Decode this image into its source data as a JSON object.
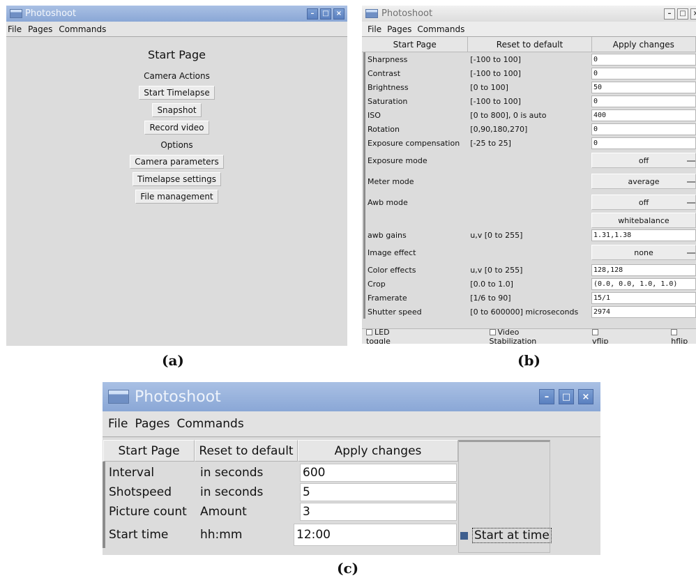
{
  "common": {
    "window_title": "Photoshoot",
    "menu": [
      "File",
      "Pages",
      "Commands"
    ],
    "window_buttons": [
      "minimize-icon",
      "maximize-icon",
      "close-icon"
    ]
  },
  "captions": {
    "a": "(a)",
    "b": "(b)",
    "c": "(c)"
  },
  "panel_a": {
    "title": "Start Page",
    "camera_actions_label": "Camera Actions",
    "camera_actions": [
      "Start Timelapse",
      "Snapshot",
      "Record video"
    ],
    "options_label": "Options",
    "options": [
      "Camera parameters",
      "Timelapse settings",
      "File management"
    ]
  },
  "panel_b": {
    "header": [
      "Start Page",
      "Reset to default",
      "Apply changes"
    ],
    "rows": [
      {
        "name": "Sharpness",
        "range": "[-100 to 100]",
        "value": "0",
        "kind": "input"
      },
      {
        "name": "Contrast",
        "range": "[-100 to 100]",
        "value": "0",
        "kind": "input"
      },
      {
        "name": "Brightness",
        "range": "[0 to 100]",
        "value": "50",
        "kind": "input"
      },
      {
        "name": "Saturation",
        "range": "[-100 to 100]",
        "value": "0",
        "kind": "input"
      },
      {
        "name": "ISO",
        "range": "[0 to 800], 0 is auto",
        "value": "400",
        "kind": "input"
      },
      {
        "name": "Rotation",
        "range": "[0,90,180,270]",
        "value": "0",
        "kind": "input"
      },
      {
        "name": "Exposure compensation",
        "range": "[-25 to 25]",
        "value": "0",
        "kind": "input"
      },
      {
        "name": "Exposure mode",
        "range": "",
        "value": "off",
        "kind": "select"
      },
      {
        "name": "Meter mode",
        "range": "",
        "value": "average",
        "kind": "select"
      },
      {
        "name": "Awb mode",
        "range": "",
        "value": "off",
        "kind": "select"
      },
      {
        "name": "",
        "range": "",
        "value": "whitebalance",
        "kind": "button"
      },
      {
        "name": "awb gains",
        "range": "u,v [0 to 255]",
        "value": "1.31,1.38",
        "kind": "input"
      },
      {
        "name": "Image effect",
        "range": "",
        "value": "none",
        "kind": "select"
      },
      {
        "name": "Color effects",
        "range": "u,v [0 to 255]",
        "value": "128,128",
        "kind": "input"
      },
      {
        "name": "Crop",
        "range": "[0.0 to 1.0]",
        "value": "(0.0, 0.0, 1.0, 1.0)",
        "kind": "input"
      },
      {
        "name": "Framerate",
        "range": "[1/6 to 90]",
        "value": "15/1",
        "kind": "input"
      },
      {
        "name": "Shutter speed",
        "range": "[0 to 600000] microseconds",
        "value": "2974",
        "kind": "input"
      }
    ],
    "toggles": [
      "LED toggle",
      "Video Stabilization",
      "vflip",
      "hflip"
    ]
  },
  "panel_c": {
    "header": [
      "Start Page",
      "Reset to default",
      "Apply changes"
    ],
    "rows": [
      {
        "name": "Interval",
        "unit": "in seconds",
        "value": "600"
      },
      {
        "name": "Shotspeed",
        "unit": "in seconds",
        "value": "5"
      },
      {
        "name": "Picture count",
        "unit": "Amount",
        "value": "3"
      },
      {
        "name": "Start time",
        "unit": "hh:mm",
        "value": "12:00"
      }
    ],
    "start_at_time_label": "Start at time",
    "start_at_time_checked": true
  },
  "colors": {
    "titlebar_active": "#8aa7d6",
    "window_bg": "#dcdcdc",
    "checkbox_checked": "#3f5f8f"
  }
}
